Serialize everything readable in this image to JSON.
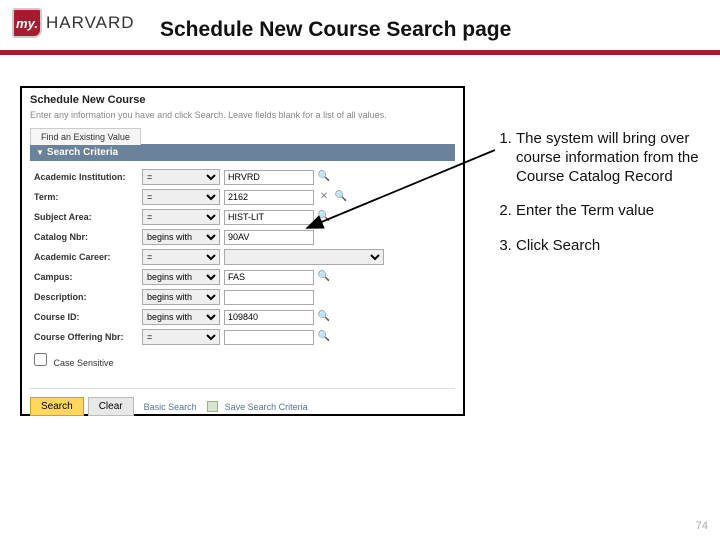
{
  "logo": {
    "badge": "my.",
    "brand": "HARVARD"
  },
  "slide_title": "Schedule New Course Search page",
  "page_num": "74",
  "screenshot": {
    "header": "Schedule New Course",
    "instruction": "Enter any information you have and click Search. Leave fields blank for a list of all values.",
    "tab_label": "Find an Existing Value",
    "criteria_header": "Search Criteria",
    "fields": {
      "institution": {
        "label": "Academic Institution:",
        "op": "=",
        "value": "HRVRD"
      },
      "term": {
        "label": "Term:",
        "op": "=",
        "value": "2162"
      },
      "subject": {
        "label": "Subject Area:",
        "op": "=",
        "value": "HIST-LIT"
      },
      "catalog": {
        "label": "Catalog Nbr:",
        "op": "begins with",
        "value": "90AV"
      },
      "career": {
        "label": "Academic Career:",
        "op": "=",
        "value": ""
      },
      "campus": {
        "label": "Campus:",
        "op": "begins with",
        "value": "FAS"
      },
      "desc": {
        "label": "Description:",
        "op": "begins with",
        "value": ""
      },
      "courseid": {
        "label": "Course ID:",
        "op": "begins with",
        "value": "109840"
      },
      "offering": {
        "label": "Course Offering Nbr:",
        "op": "=",
        "value": ""
      }
    },
    "case_sensitive_label": "Case Sensitive",
    "buttons": {
      "search": "Search",
      "clear": "Clear"
    },
    "links": {
      "basic": "Basic Search",
      "save": "Save Search Criteria"
    }
  },
  "notes": {
    "item1": "The system will bring over course information from the Course Catalog Record",
    "item2": "Enter the Term value",
    "item3": "Click Search"
  }
}
